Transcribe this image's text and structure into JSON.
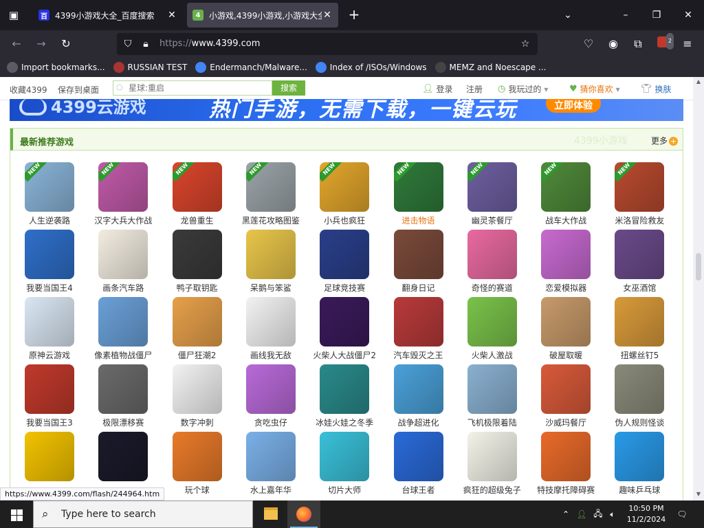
{
  "tabs": [
    {
      "title": "4399小游戏大全_百度搜索",
      "favicon_label": "百"
    },
    {
      "title": "小游戏,4399小游戏,小游戏大全",
      "favicon_label": "4"
    }
  ],
  "url": {
    "protocol": "https://",
    "host": "www.4399.com"
  },
  "extensions": {
    "badge_count": "2"
  },
  "bookmarks": [
    {
      "label": "Import bookmarks...",
      "color": "#5b5b66"
    },
    {
      "label": "RUSSIAN TEST",
      "color": "#a33"
    },
    {
      "label": "Endermanch/Malware...",
      "color": "#4285f4"
    },
    {
      "label": "Index of /ISOs/Windows",
      "color": "#4285f4"
    },
    {
      "label": "MEMZ and Noescape ...",
      "color": "#444"
    }
  ],
  "site": {
    "collect": "收藏4399",
    "save_desktop": "保存到桌面",
    "search_placeholder": "星球:重启",
    "search_button": "搜索",
    "login": "登录",
    "register": "注册",
    "played": "我玩过的",
    "favorites": "猜你喜欢",
    "skin": "换肤"
  },
  "banner": {
    "logo": "4399云游戏",
    "slogan": "热门手游，无需下载，一键云玩",
    "cta": "立即体验"
  },
  "section": {
    "title": "最新推荐游戏",
    "watermark": "4399小游戏",
    "more": "更多"
  },
  "games": [
    {
      "name": "人生逆袭路",
      "new": true,
      "color": "#8ab4d8"
    },
    {
      "name": "汉字大兵大作战",
      "new": true,
      "color": "#c05aa8"
    },
    {
      "name": "龙兽重生",
      "new": true,
      "color": "#d9452b"
    },
    {
      "name": "黑莲花攻略图鉴",
      "new": true,
      "color": "#9aa3a8"
    },
    {
      "name": "小兵也疯狂",
      "new": true,
      "color": "#e2a62c"
    },
    {
      "name": "进击物语",
      "new": true,
      "color": "#2f7a3a",
      "highlight": true
    },
    {
      "name": "幽灵茶餐厅",
      "new": true,
      "color": "#6d5fa0"
    },
    {
      "name": "战车大作战",
      "new": true,
      "color": "#4f8a3a"
    },
    {
      "name": "米洛冒险救友",
      "new": true,
      "color": "#b84a2f"
    },
    {
      "name": "我要当国王4",
      "color": "#2f6fc9"
    },
    {
      "name": "画条汽车路",
      "color": "#f2ece0"
    },
    {
      "name": "鸭子取钥匙",
      "color": "#3a3a3a"
    },
    {
      "name": "呆鹅与笨鲨",
      "color": "#e8c54a"
    },
    {
      "name": "足球竞技赛",
      "color": "#2a3f8a"
    },
    {
      "name": "翻身日记",
      "color": "#7a4a3a"
    },
    {
      "name": "奇怪的赛道",
      "color": "#e86aa0"
    },
    {
      "name": "恋爱模拟器",
      "color": "#c76ad0"
    },
    {
      "name": "女巫酒馆",
      "color": "#6a4a8a"
    },
    {
      "name": "原神云游戏",
      "color": "#d9e6f2"
    },
    {
      "name": "像素植物战僵尸",
      "color": "#6aa0d8"
    },
    {
      "name": "僵尸狂潮2",
      "color": "#e6a04a"
    },
    {
      "name": "画线我无敌",
      "color": "#f2f2f2"
    },
    {
      "name": "火柴人大战僵尸2",
      "color": "#3a1a5a"
    },
    {
      "name": "汽车毁灭之王",
      "color": "#b83a3a"
    },
    {
      "name": "火柴人激战",
      "color": "#7ac24a"
    },
    {
      "name": "破屋取暖",
      "color": "#c79a6a"
    },
    {
      "name": "扭螺丝钉5",
      "color": "#d89a3a"
    },
    {
      "name": "我要当国王3",
      "color": "#c0392b"
    },
    {
      "name": "极限漂移赛",
      "color": "#6a6a6a"
    },
    {
      "name": "数字冲刺",
      "color": "#f2f2f2"
    },
    {
      "name": "贪吃虫仔",
      "color": "#b86ad8"
    },
    {
      "name": "冰娃火娃之冬季",
      "color": "#2a8a8a"
    },
    {
      "name": "战争超进化",
      "color": "#4aa0d8"
    },
    {
      "name": "飞机极限着陆",
      "color": "#8ab0d0"
    },
    {
      "name": "沙威玛餐厅",
      "color": "#d85a3a"
    },
    {
      "name": "伪人规则怪谈",
      "color": "#8a8a7a"
    },
    {
      "name": "",
      "color": "#f2c200"
    },
    {
      "name": "",
      "color": "#1a1a2a"
    },
    {
      "name": "玩个球",
      "color": "#e87a2a"
    },
    {
      "name": "水上嘉年华",
      "color": "#7ab0e8"
    },
    {
      "name": "切片大师",
      "color": "#3ac0d8"
    },
    {
      "name": "台球王者",
      "color": "#2a6ad8"
    },
    {
      "name": "疯狂的超级兔子",
      "color": "#f2f2e8"
    },
    {
      "name": "特技摩托障碍赛",
      "color": "#e86a2a"
    },
    {
      "name": "趣味乒乓球",
      "color": "#2a9ae8"
    }
  ],
  "status_link": "https://www.4399.com/flash/244964.htm",
  "taskbar": {
    "search_placeholder": "Type here to search",
    "time": "10:50 PM",
    "date": "11/2/2024"
  }
}
